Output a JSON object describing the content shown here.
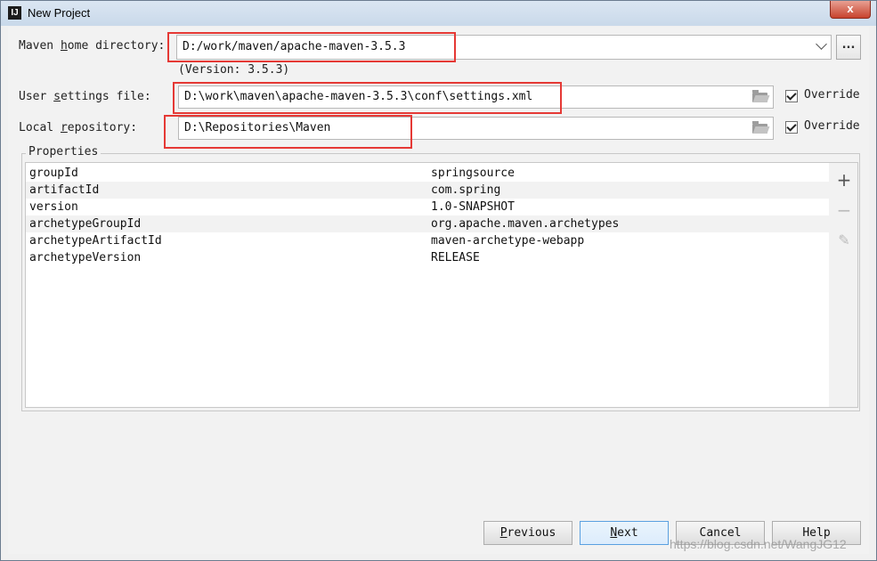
{
  "window": {
    "title": "New Project",
    "close_glyph": "x",
    "app_icon_letter": "IJ"
  },
  "maven_home": {
    "label_prefix": "Maven ",
    "label_accel": "h",
    "label_suffix": "ome directory:",
    "value": "D:/work/maven/apache-maven-3.5.3",
    "version": "(Version: 3.5.3)",
    "browse_label": "..."
  },
  "user_settings": {
    "label_prefix": "User ",
    "label_accel": "s",
    "label_suffix": "ettings file:",
    "value": "D:\\work\\maven\\apache-maven-3.5.3\\conf\\settings.xml",
    "override_label": "Override",
    "override_checked": true
  },
  "local_repo": {
    "label_prefix": "Local ",
    "label_accel": "r",
    "label_suffix": "epository:",
    "value": "D:\\Repositories\\Maven",
    "override_label": "Override",
    "override_checked": true
  },
  "properties": {
    "title": "Properties",
    "rows": [
      {
        "key": "groupId",
        "value": "springsource"
      },
      {
        "key": "artifactId",
        "value": "com.spring"
      },
      {
        "key": "version",
        "value": "1.0-SNAPSHOT"
      },
      {
        "key": "archetypeGroupId",
        "value": "org.apache.maven.archetypes"
      },
      {
        "key": "archetypeArtifactId",
        "value": "maven-archetype-webapp"
      },
      {
        "key": "archetypeVersion",
        "value": "RELEASE"
      }
    ],
    "tools": {
      "add": "+",
      "remove": "−",
      "edit": "✎"
    }
  },
  "buttons": {
    "previous": {
      "accel": "P",
      "rest": "revious"
    },
    "next": {
      "accel": "N",
      "rest": "ext"
    },
    "cancel": "Cancel",
    "help": "Help"
  },
  "watermark": "https://blog.csdn.net/WangJG12",
  "colors": {
    "highlight": "#e53935",
    "default_button_border": "#5aa0e0"
  }
}
